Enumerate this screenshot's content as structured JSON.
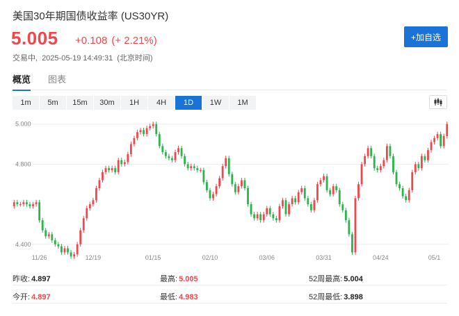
{
  "header": {
    "title": "美国30年期国债收益率 (US30YR)",
    "price": "5.005",
    "change": "+0.108",
    "change_pct": "(+ 2.21%)",
    "status": "交易中,",
    "timestamp": "2025-05-19 14:49:31",
    "timezone": "(北京时间)"
  },
  "actions": {
    "watchlist_label": "+加自选"
  },
  "tabs": [
    {
      "label": "概览",
      "active": true
    },
    {
      "label": "图表",
      "active": false
    }
  ],
  "periods": [
    {
      "label": "1m",
      "active": false
    },
    {
      "label": "5m",
      "active": false
    },
    {
      "label": "15m",
      "active": false
    },
    {
      "label": "30m",
      "active": false
    },
    {
      "label": "1H",
      "active": false
    },
    {
      "label": "4H",
      "active": false
    },
    {
      "label": "1D",
      "active": true
    },
    {
      "label": "1W",
      "active": false
    },
    {
      "label": "1M",
      "active": false
    }
  ],
  "stats": {
    "prev_close_label": "昨收:",
    "prev_close": "4.897",
    "open_label": "今开:",
    "open": "4.897",
    "high_label": "最高:",
    "high": "5.005",
    "low_label": "最低:",
    "low": "4.983",
    "high52_label": "52周最高:",
    "high52": "5.004",
    "low52_label": "52周最低:",
    "low52": "3.898"
  },
  "colors": {
    "up": "#f0474c",
    "down": "#2bb44a",
    "accent": "#1a73d6"
  },
  "chart_data": {
    "type": "candlestick",
    "y_ticks": [
      "5.000",
      "4.800",
      "4.400"
    ],
    "y_tick_values": [
      5.0,
      4.8,
      4.4
    ],
    "ylim": [
      4.33,
      5.03
    ],
    "x_ticks": [
      "11/26",
      "12/19",
      "01/15",
      "02/10",
      "03/06",
      "03/31",
      "04/24",
      "05/1"
    ],
    "x_tick_index": [
      8,
      25,
      44,
      62,
      80,
      98,
      116,
      133
    ],
    "grid": true,
    "close": [
      4.61,
      4.6,
      4.6,
      4.61,
      4.6,
      4.59,
      4.6,
      4.61,
      4.52,
      4.47,
      4.44,
      4.45,
      4.42,
      4.4,
      4.39,
      4.36,
      4.38,
      4.36,
      4.34,
      4.35,
      4.4,
      4.47,
      4.53,
      4.58,
      4.6,
      4.62,
      4.68,
      4.72,
      4.76,
      4.78,
      4.77,
      4.78,
      4.76,
      4.82,
      4.8,
      4.81,
      4.85,
      4.9,
      4.93,
      4.96,
      4.97,
      4.95,
      4.98,
      4.99,
      5.0,
      4.95,
      4.89,
      4.86,
      4.84,
      4.83,
      4.82,
      4.86,
      4.88,
      4.84,
      4.8,
      4.78,
      4.79,
      4.78,
      4.77,
      4.77,
      4.71,
      4.67,
      4.63,
      4.65,
      4.69,
      4.73,
      4.79,
      4.83,
      4.75,
      4.7,
      4.66,
      4.69,
      4.72,
      4.68,
      4.6,
      4.55,
      4.53,
      4.55,
      4.52,
      4.55,
      4.58,
      4.55,
      4.53,
      4.52,
      4.59,
      4.62,
      4.55,
      4.6,
      4.63,
      4.61,
      4.66,
      4.68,
      4.63,
      4.6,
      4.57,
      4.62,
      4.7,
      4.72,
      4.74,
      4.67,
      4.65,
      4.69,
      4.67,
      4.6,
      4.57,
      4.52,
      4.45,
      4.36,
      4.63,
      4.7,
      4.8,
      4.84,
      4.88,
      4.84,
      4.78,
      4.77,
      4.79,
      4.82,
      4.89,
      4.84,
      4.76,
      4.7,
      4.68,
      4.64,
      4.62,
      4.67,
      4.76,
      4.8,
      4.78,
      4.84,
      4.82,
      4.87,
      4.91,
      4.93,
      4.95,
      4.89,
      4.94,
      5.0
    ]
  }
}
